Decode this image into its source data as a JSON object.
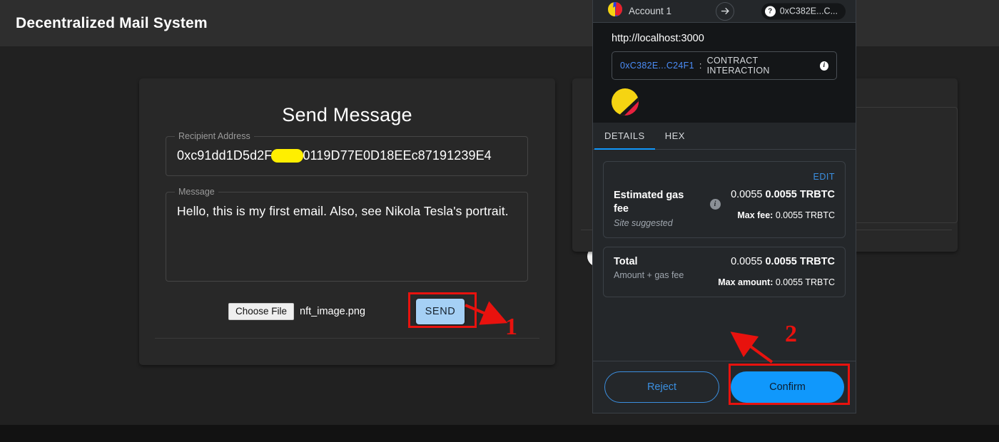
{
  "app": {
    "title": "Decentralized Mail System"
  },
  "send_card": {
    "title": "Send Message",
    "recipient": {
      "legend": "Recipient Address",
      "value_before_redaction": "0xc91dd1D5d2F",
      "value_after_redaction": "0119D77E0D18EEc87191239E4"
    },
    "message": {
      "legend": "Message",
      "value": "Hello, this is my first email. Also, see Nikola Tesla's portrait."
    },
    "file_input": {
      "button_label": "Choose File",
      "file_name": "nft_image.png"
    },
    "send_button_label": "SEND",
    "grammarly": {
      "bulb_icon": "lightbulb-icon",
      "logo_icon": "grammarly-g-icon"
    }
  },
  "metamask": {
    "header": {
      "account_name": "Account 1",
      "account_avatar_icon": "jazzicon-avatar",
      "transfer_arrow_icon": "arrow-right-icon",
      "question_badge": "?",
      "contract_short": "0xC382E...C..."
    },
    "origin": {
      "url": "http://localhost:3000",
      "contract_address": "0xC382E...C24F1",
      "separator": ":",
      "action_label": "CONTRACT INTERACTION",
      "info_icon": "info-icon",
      "jazzicon": "contract-jazzicon"
    },
    "tabs": [
      {
        "label": "DETAILS",
        "active": true
      },
      {
        "label": "HEX",
        "active": false
      }
    ],
    "gas_panel": {
      "edit_label": "EDIT",
      "label": "Estimated gas fee",
      "sublabel": "Site suggested",
      "info_icon": "info-icon",
      "fiat_amount": "0.0055",
      "crypto_amount": "0.0055 TRBTC",
      "max_fee_label": "Max fee:",
      "max_fee_value": "0.0055 TRBTC"
    },
    "total_panel": {
      "label": "Total",
      "sublabel": "Amount + gas fee",
      "fiat_amount": "0.0055",
      "crypto_amount": "0.0055 TRBTC",
      "max_amount_label": "Max amount:",
      "max_amount_value": "0.0055 TRBTC"
    },
    "footer": {
      "reject_label": "Reject",
      "confirm_label": "Confirm"
    }
  },
  "annotations": {
    "step_one": "1",
    "step_two": "2",
    "color": "#e8120e"
  },
  "colors": {
    "page_background": "#212121",
    "appbar": "#2e2e2e",
    "card": "#282828",
    "metamask_background": "#24272a",
    "metamask_origin": "#141618",
    "accent_blue": "#1098fc",
    "link_blue": "#3b8fe0",
    "send_button": "#a5d0f5",
    "redaction": "#ffef00"
  }
}
